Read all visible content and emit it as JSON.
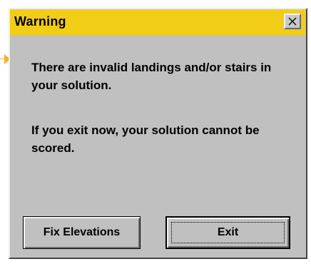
{
  "dialog": {
    "title": "Warning",
    "message_line_group_1": "There are invalid landings and/or stairs in your solution.",
    "message_line_group_2": "If you exit now, your solution cannot be scored.",
    "buttons": {
      "fix_elevations": "Fix Elevations",
      "exit": "Exit"
    },
    "icons": {
      "close": "close-icon",
      "pointer": "pointer-arrow-icon"
    },
    "colors": {
      "titlebar": "#f2cd18",
      "window": "#c0c0c0",
      "pointer": "#f2b233"
    }
  }
}
